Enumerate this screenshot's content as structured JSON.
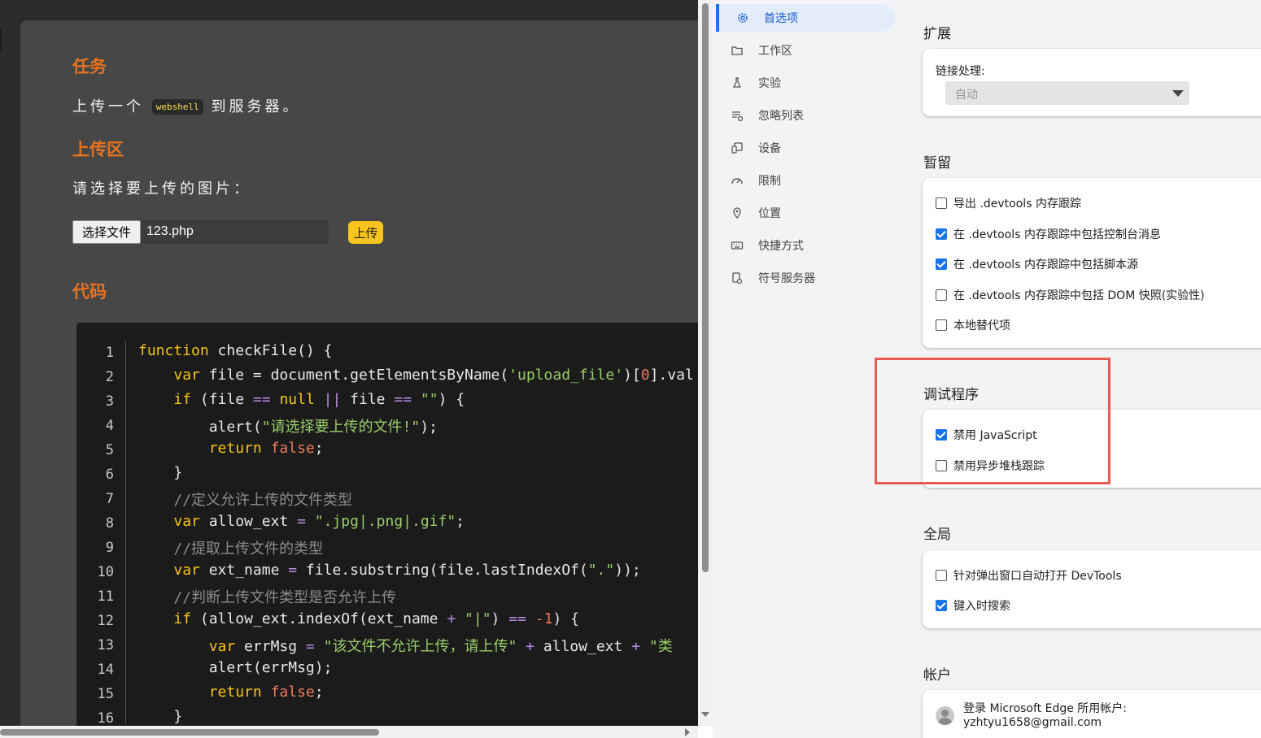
{
  "page": {
    "task_heading": "任务",
    "task_text_before": "上传一个",
    "task_code": "webshell",
    "task_text_after": "到服务器。",
    "upload_heading": "上传区",
    "upload_prompt": "请选择要上传的图片：",
    "choose_file_label": "选择文件",
    "file_name": "123.php",
    "upload_button": "上传",
    "code_heading": "代码"
  },
  "code_lines": [
    {
      "n": "1"
    },
    {
      "n": "2"
    },
    {
      "n": "3"
    },
    {
      "n": "4"
    },
    {
      "n": "5"
    },
    {
      "n": "6"
    },
    {
      "n": "7"
    },
    {
      "n": "8"
    },
    {
      "n": "9"
    },
    {
      "n": "10"
    },
    {
      "n": "11"
    },
    {
      "n": "12"
    },
    {
      "n": "13"
    },
    {
      "n": "14"
    },
    {
      "n": "15"
    },
    {
      "n": "16"
    }
  ],
  "code": {
    "l1": [
      "function",
      " checkFile() {"
    ],
    "l2": [
      "    ",
      "var",
      " file = document.getElementsByName(",
      "'upload_file'",
      ")[",
      "0",
      "].val"
    ],
    "l3": [
      "    ",
      "if",
      " (file ",
      "==",
      " ",
      "null",
      " ",
      "||",
      " file ",
      "==",
      " ",
      "\"\"",
      ") {"
    ],
    "l4": [
      "        alert(",
      "\"请选择要上传的文件!\"",
      ");"
    ],
    "l5": [
      "        ",
      "return",
      " ",
      "false",
      ";"
    ],
    "l6": [
      "    }"
    ],
    "l7": [
      "    ",
      "//定义允许上传的文件类型"
    ],
    "l8": [
      "    ",
      "var",
      " allow_ext ",
      "=",
      " ",
      "\".jpg|.png|.gif\"",
      ";"
    ],
    "l9": [
      "    ",
      "//提取上传文件的类型"
    ],
    "l10": [
      "    ",
      "var",
      " ext_name ",
      "=",
      " file.substring(file.lastIndexOf(",
      "\".\"",
      "));"
    ],
    "l11": [
      "    ",
      "//判断上传文件类型是否允许上传"
    ],
    "l12": [
      "    ",
      "if",
      " (allow_ext.indexOf(ext_name ",
      "+",
      " ",
      "\"|\"",
      ") ",
      "==",
      " ",
      "-1",
      ") {"
    ],
    "l13": [
      "        ",
      "var",
      " errMsg ",
      "=",
      " ",
      "\"该文件不允许上传，请上传\"",
      " ",
      "+",
      " allow_ext ",
      "+",
      " ",
      "\"类"
    ],
    "l14": [
      "        alert(errMsg);"
    ],
    "l15": [
      "        ",
      "return",
      " ",
      "false",
      ";"
    ],
    "l16": [
      "    }"
    ]
  },
  "nav": {
    "items": [
      {
        "label": "首选项",
        "icon": "gear-icon"
      },
      {
        "label": "工作区",
        "icon": "folder-icon"
      },
      {
        "label": "实验",
        "icon": "flask-icon"
      },
      {
        "label": "忽略列表",
        "icon": "ignore-list-icon"
      },
      {
        "label": "设备",
        "icon": "devices-icon"
      },
      {
        "label": "限制",
        "icon": "throttle-icon"
      },
      {
        "label": "位置",
        "icon": "location-pin-icon"
      },
      {
        "label": "快捷方式",
        "icon": "keyboard-icon"
      },
      {
        "label": "符号服务器",
        "icon": "symbol-server-icon"
      }
    ]
  },
  "sections": {
    "extensions": {
      "title": "扩展",
      "link_label": "链接处理:",
      "link_value": "自动"
    },
    "persistence": {
      "title": "暂留",
      "options": [
        {
          "label": "导出 .devtools 内存跟踪",
          "checked": false
        },
        {
          "label": "在 .devtools 内存跟踪中包括控制台消息",
          "checked": true
        },
        {
          "label": "在 .devtools 内存跟踪中包括脚本源",
          "checked": true
        },
        {
          "label": "在 .devtools 内存跟踪中包括 DOM 快照(实验性)",
          "checked": false
        },
        {
          "label": "本地替代项",
          "checked": false
        }
      ]
    },
    "debugger": {
      "title": "调试程序",
      "options": [
        {
          "label": "禁用 JavaScript",
          "checked": true
        },
        {
          "label": "禁用异步堆栈跟踪",
          "checked": false
        }
      ]
    },
    "global": {
      "title": "全局",
      "options": [
        {
          "label": "针对弹出窗口自动打开 DevTools",
          "checked": false
        },
        {
          "label": "键入时搜索",
          "checked": true
        }
      ]
    },
    "account": {
      "title": "帐户",
      "line1": "登录 Microsoft Edge 所用帐户:",
      "email": "yzhtyu1658@gmail.com"
    }
  },
  "colors": {
    "accent": "#1a73e8",
    "heading": "#e8731f",
    "highlight": "#e85a55",
    "upload_button": "#f7c51d"
  }
}
